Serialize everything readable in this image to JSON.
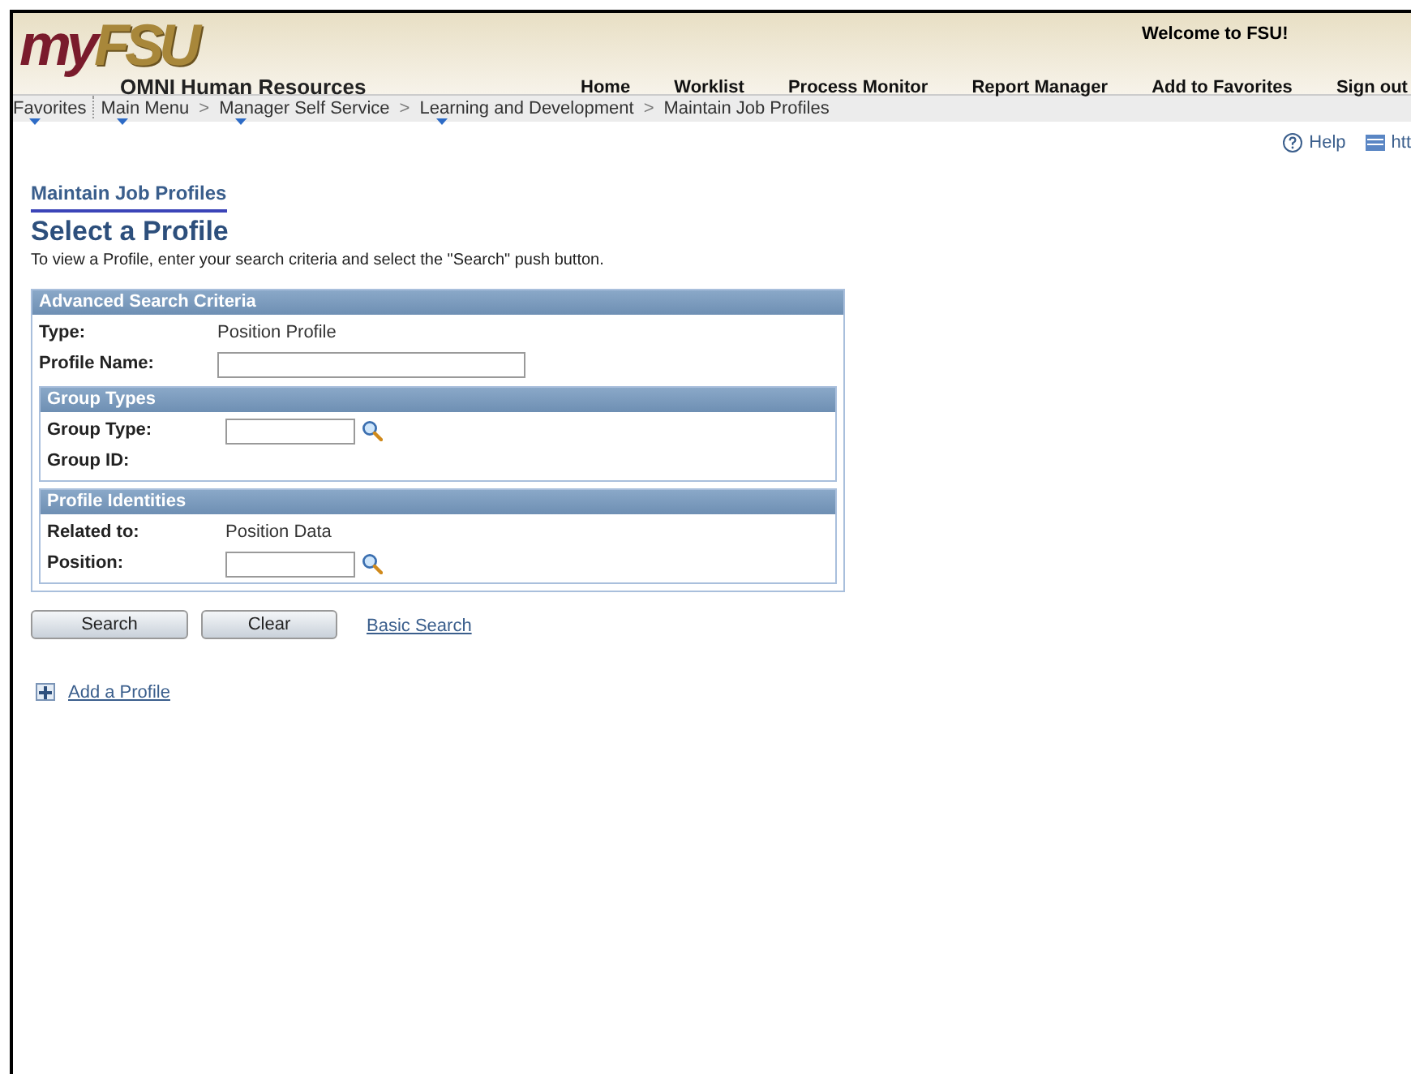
{
  "header": {
    "logo_dark": "my",
    "logo_light": "FSU",
    "app_name": "OMNI Human Resources",
    "welcome": "Welcome to FSU!",
    "nav": [
      "Home",
      "Worklist",
      "Process Monitor",
      "Report Manager",
      "Add to Favorites",
      "Sign out"
    ]
  },
  "breadcrumb": [
    {
      "label": "Favorites",
      "has_menu": true
    },
    {
      "label": "Main Menu",
      "has_menu": true
    },
    {
      "label": "Manager Self Service",
      "has_menu": true
    },
    {
      "label": "Learning and Development",
      "has_menu": true
    },
    {
      "label": "Maintain Job Profiles",
      "has_menu": false
    }
  ],
  "breadcrumb_separator": ">",
  "toolbar": {
    "help": "Help",
    "link": "htt"
  },
  "page_tab": "Maintain Job Profiles",
  "title": "Select a Profile",
  "instructions": "To view a Profile, enter your search criteria and select the \"Search\" push button.",
  "panel": {
    "title": "Advanced Search Criteria",
    "fields": [
      {
        "kind": "text",
        "label": "Type:",
        "value": "Position Profile"
      },
      {
        "kind": "input",
        "label": "Profile Name:",
        "lookup": false
      }
    ],
    "groups": [
      {
        "title": "Group Types",
        "fields": [
          {
            "kind": "input",
            "label": "Group Type:",
            "lookup": true
          },
          {
            "kind": "text",
            "label": "Group ID:"
          }
        ]
      },
      {
        "title": "Profile Identities",
        "fields": [
          {
            "kind": "text",
            "label": "Related to:",
            "value": "Position Data"
          },
          {
            "kind": "input",
            "label": "Position:",
            "lookup": true
          }
        ]
      }
    ]
  },
  "buttons": [
    "Search",
    "Clear"
  ],
  "basic_search": "Basic Search",
  "add_link": "Add a Profile"
}
